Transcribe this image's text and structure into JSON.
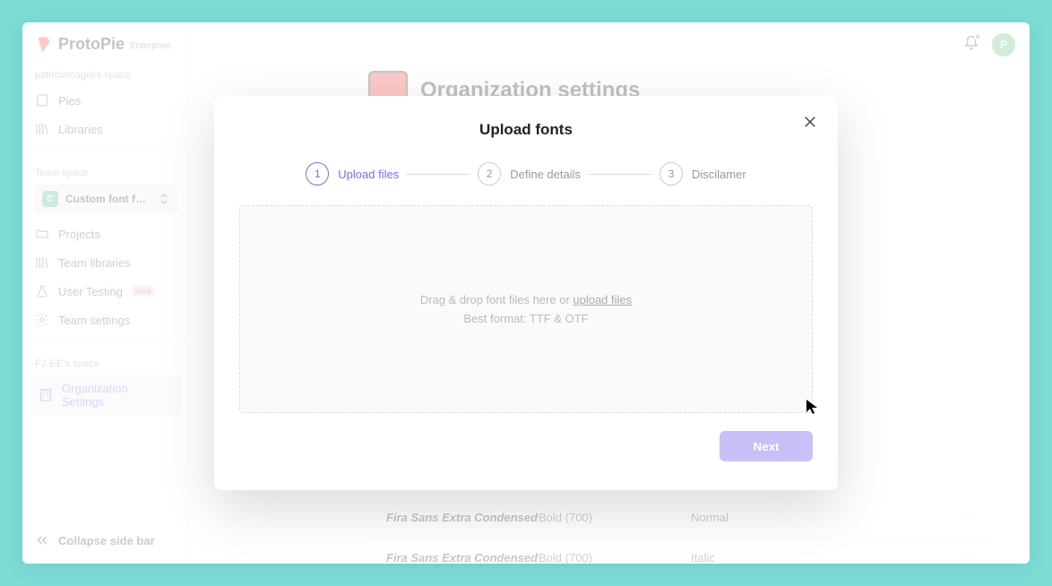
{
  "brand": {
    "name": "ProtoPie",
    "tier": "Enterprise"
  },
  "user": {
    "space_label": "patriciamagro's space",
    "avatar_initial": "P"
  },
  "nav": {
    "pies": "Pies",
    "libraries": "Libraries"
  },
  "team": {
    "section": "Team space",
    "chip": "C",
    "name": "Custom font for …",
    "projects": "Projects",
    "team_libraries": "Team libraries",
    "user_testing": "User Testing",
    "user_testing_tag": "beta",
    "team_settings": "Team settings"
  },
  "org": {
    "section": "F2-EE's space",
    "settings": "Organization Settings"
  },
  "collapse": "Collapse side bar",
  "page": {
    "title": "Organization settings"
  },
  "fonts": [
    {
      "name": "Fira Sans Extra Condensed",
      "weight": "Bold (700)",
      "style": "Normal"
    },
    {
      "name": "Fira Sans Extra Condensed",
      "weight": "Bold (700)",
      "style": "Italic"
    }
  ],
  "modal": {
    "title": "Upload fonts",
    "steps": {
      "s1": "Upload files",
      "s2": "Define details",
      "s3": "Discilamer"
    },
    "dropzone": {
      "text_prefix": "Drag & drop font files here or ",
      "link": "upload files",
      "hint": "Best format: TTF & OTF"
    },
    "next": "Next"
  }
}
